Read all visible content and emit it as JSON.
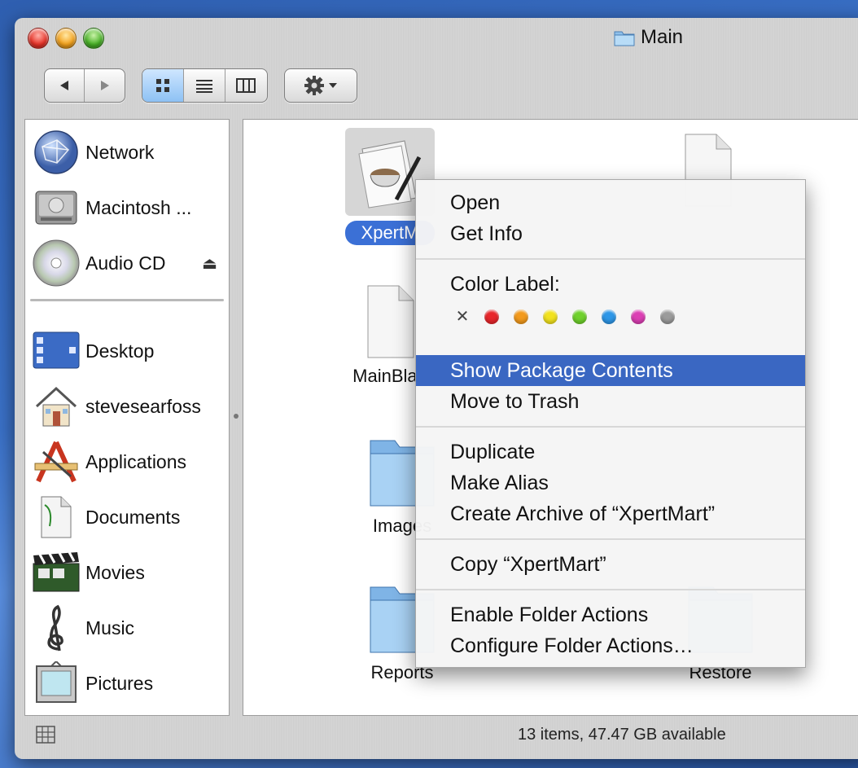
{
  "window": {
    "title": "Main"
  },
  "toolbar": {
    "back_icon": "back-arrow-icon",
    "forward_icon": "forward-arrow-icon",
    "view_icons": [
      "icon-view-icon",
      "list-view-icon",
      "column-view-icon"
    ],
    "action_icon": "gear-icon"
  },
  "sidebar": {
    "devices": [
      {
        "label": "Network",
        "icon": "network-globe-icon"
      },
      {
        "label": "Macintosh ...",
        "icon": "hard-drive-icon"
      },
      {
        "label": "Audio CD",
        "icon": "cd-icon",
        "eject": "⏏"
      }
    ],
    "places": [
      {
        "label": "Desktop",
        "icon": "desktop-icon"
      },
      {
        "label": "stevesearfoss",
        "icon": "home-icon"
      },
      {
        "label": "Applications",
        "icon": "applications-icon"
      },
      {
        "label": "Documents",
        "icon": "documents-icon"
      },
      {
        "label": "Movies",
        "icon": "clapperboard-icon"
      },
      {
        "label": "Music",
        "icon": "music-clef-icon"
      },
      {
        "label": "Pictures",
        "icon": "picture-frame-icon"
      }
    ]
  },
  "files": [
    {
      "label": "XpertM",
      "icon": "application-package-icon",
      "selected": true
    },
    {
      "label": "MainBlan",
      "icon": "document-icon"
    },
    {
      "label": "Images",
      "icon": "folder-icon"
    },
    {
      "label": "Reports",
      "icon": "folder-icon"
    },
    {
      "label": "",
      "icon": "document-icon"
    },
    {
      "label": "Restore",
      "icon": "folder-icon"
    }
  ],
  "context_menu": {
    "open": "Open",
    "get_info": "Get Info",
    "color_label": "Color Label:",
    "colors": [
      "#e8262b",
      "#f39a1c",
      "#f2e21e",
      "#6fd12c",
      "#2e97e8",
      "#dc3fb4",
      "#9b9b9b"
    ],
    "show_package_contents": "Show Package Contents",
    "move_to_trash": "Move to Trash",
    "duplicate": "Duplicate",
    "make_alias": "Make Alias",
    "create_archive": "Create Archive of “XpertMart”",
    "copy": "Copy “XpertMart”",
    "enable_folder_actions": "Enable Folder Actions",
    "configure_folder_actions": "Configure Folder Actions…"
  },
  "status": {
    "text": "13 items, 47.47 GB available"
  }
}
